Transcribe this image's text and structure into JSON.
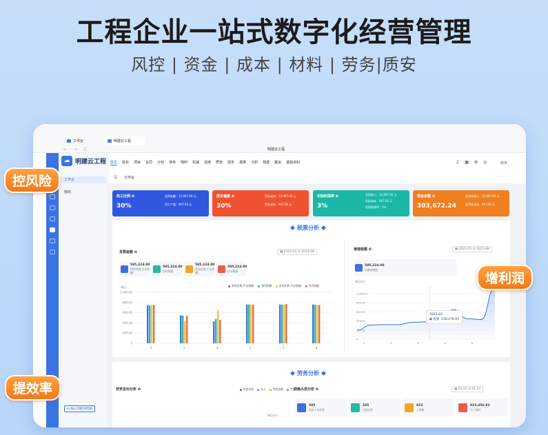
{
  "hero": {
    "title": "工程企业一站式数字化经营管理",
    "subtitle": "风控 | 资金 | 成本 | 材料 | 劳务|质安"
  },
  "browser": {
    "tab1": "工作台",
    "tab2": "明建云工程",
    "nav_controls": "← → C",
    "window_title": "明建云工程"
  },
  "app": {
    "brand": "明建云工程",
    "menu": [
      "首页",
      "投标",
      "项目",
      "合同",
      "分包",
      "劳务",
      "物料",
      "机械",
      "进度",
      "质安",
      "财务",
      "报表",
      "分析",
      "档案",
      "集采",
      "基础资料"
    ],
    "tool_icons": "♫ ▦ ⚙ ◎",
    "user": "财务",
    "breadcrumb_icon": "☰",
    "breadcrumb": "工作台"
  },
  "sidebar": {
    "items": [
      "工作台",
      "我的"
    ],
    "bottom_button": "◎ 核心功能导航图"
  },
  "kpis": [
    {
      "title": "完工比例 ❷",
      "value": "30%",
      "lines": [
        "合同金额：15,907.00 元",
        "完工产值：907.00 元"
      ],
      "color": "#2f57e0"
    },
    {
      "title": "成本偏差 ❷",
      "value": "30%",
      "lines": [
        "目标成本：15,907.00 元",
        "实际成本：907.00 元"
      ],
      "color": "#f0522f"
    },
    {
      "title": "实际利润率 ❷",
      "value": "3%",
      "lines": [
        "合同收入：15,907.00 元",
        "实际成本：907.00 元",
        "合同利润率：5%"
      ],
      "color": "#1bb7a6"
    },
    {
      "title": "现金余额 ❷",
      "value": "303,672.24",
      "lines": [
        "总资金流入：15,907.00 元",
        "总资金流出：907.00 元"
      ],
      "color": "#f07f22"
    }
  ],
  "section_tax": "税票分析",
  "section_labor": "劳务分析",
  "invoice": {
    "label": "发票金额 ❷",
    "date_range": "▦ 2023-01 ⇄ 2023-08",
    "cards": [
      {
        "value": "585,224.00",
        "caption": "销项发票(不含税额)",
        "color": "#3f6fe0"
      },
      {
        "value": "585,224.00",
        "caption": "销项税额",
        "color": "#28b7a0"
      },
      {
        "value": "585,224.00",
        "caption": "进项发票(不含税额)",
        "color": "#f3a52b"
      },
      {
        "value": "585,224.00",
        "caption": "进项税额",
        "color": "#ec5a4a"
      }
    ],
    "unit": "单位",
    "legend": [
      "销项发票(不含税额)",
      "销项税额",
      "进项发票(不含税额)",
      "进项税额"
    ]
  },
  "vat": {
    "label": "增值税额 ❷",
    "date_range": "▦ 2023-01 ⇄ 2023-08",
    "total_value": "585,224.00",
    "total_caption": "总缴纳税额",
    "unit": "单位(元)",
    "tooltip_title": "2021-03",
    "tooltip_series": "● 金额",
    "tooltip_value": "156,276.03"
  },
  "labor": {
    "label": "劳务支出分析 ❷",
    "legend": [
      "劳务合同",
      "实工",
      "劳务结算",
      "劳务计量支付"
    ],
    "unit": "单位(元)",
    "right_label": "劳务人员分析 ❷",
    "date_range": "▦ 01-01 ⇄ 01-24",
    "cards": [
      {
        "value": "585",
        "caption": "劳务人员总数",
        "color": "#3f6fe0"
      },
      {
        "value": "245",
        "caption": "当前在职",
        "color": "#28b7a0"
      },
      {
        "value": "823",
        "caption": "工种数",
        "color": "#f3a52b"
      },
      {
        "value": "823,456.83",
        "caption": "员工福利",
        "color": "#ec5a4a"
      }
    ]
  },
  "bubbles": {
    "risk": "控风险",
    "profit": "增利润",
    "efficiency": "提效率"
  },
  "chart_data": [
    {
      "type": "bar",
      "title": "发票金额",
      "categories": [
        "1",
        "2",
        "3",
        "4",
        "5",
        "6"
      ],
      "series": [
        {
          "name": "销项发票(不含税额)",
          "values": [
            750,
            550,
            430,
            760,
            760,
            760
          ],
          "color": "#3f6fe0"
        },
        {
          "name": "销项税额",
          "values": [
            740,
            540,
            480,
            760,
            760,
            760
          ],
          "color": "#28b7a0"
        },
        {
          "name": "进项发票(不含税额)",
          "values": [
            750,
            430,
            650,
            760,
            760,
            750
          ],
          "color": "#f3c33b"
        },
        {
          "name": "进项税额",
          "values": [
            750,
            540,
            460,
            760,
            770,
            750
          ],
          "color": "#ec6a4a"
        }
      ],
      "yticks": [
        "0",
        "200.00",
        "400.00",
        "600.00",
        "800.00",
        "1,000.00"
      ],
      "ylim": [
        0,
        1000
      ]
    },
    {
      "type": "area",
      "title": "增值税额",
      "x": [
        "1",
        "2",
        "3",
        "4",
        "5",
        "6"
      ],
      "series": [
        {
          "name": "金额",
          "values": [
            200,
            310,
            320,
            320,
            370,
            380,
            360,
            650,
            450,
            430,
            1150
          ]
        }
      ],
      "yticks": [
        "0",
        "200.00",
        "400.00",
        "600.00",
        "800.00",
        "1,000.00"
      ],
      "ylim": [
        0,
        1150
      ]
    }
  ]
}
